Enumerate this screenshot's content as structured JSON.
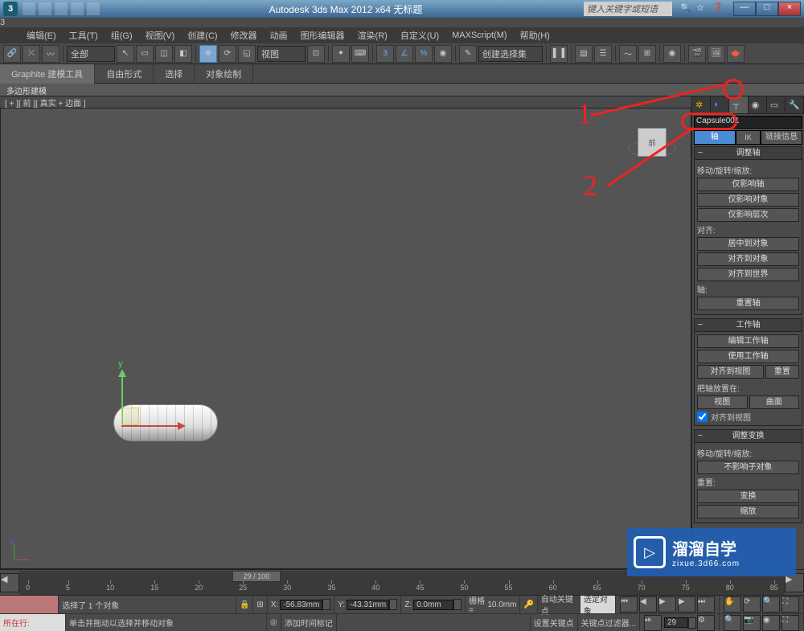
{
  "title": "Autodesk 3ds Max 2012 x64   无标题",
  "searchbox_placeholder": "键入关键字或短语",
  "win": {
    "min": "—",
    "max": "□",
    "close": "×"
  },
  "menus": [
    "编辑(E)",
    "工具(T)",
    "组(G)",
    "视图(V)",
    "创建(C)",
    "修改器",
    "动画",
    "图形编辑器",
    "渲染(R)",
    "自定义(U)",
    "MAXScript(M)",
    "帮助(H)"
  ],
  "toolbar": {
    "layer_dd": "全部",
    "selset_dd": "创建选择集",
    "view_dd": "视图"
  },
  "ribbon": {
    "t1": "Graphite 建模工具",
    "t2": "自由形式",
    "t3": "选择",
    "t4": "对象绘制",
    "sub": "多边形建模"
  },
  "viewport_label": "[ + ][ 前 ][ 真实 + 边面 ]",
  "viewcube": "前",
  "gizmo": {
    "y": "y"
  },
  "cmd": {
    "obj_name": "Capsule001",
    "subtabs": {
      "pivot": "轴",
      "ik": "IK",
      "link": "链接信息"
    },
    "r1": {
      "header": "调整轴",
      "label1": "移动/旋转/缩放:",
      "b1": "仅影响轴",
      "b2": "仅影响对象",
      "b3": "仅影响层次",
      "label2": "对齐:",
      "b4": "居中到对象",
      "b5": "对齐到对象",
      "b6": "对齐到世界",
      "label3": "轴:",
      "b7": "重置轴"
    },
    "r2": {
      "header": "工作轴",
      "b1": "编辑工作轴",
      "b2": "使用工作轴",
      "b3": "对齐到视图",
      "b4": "重置",
      "label1": "把轴放置在:",
      "b5": "视图",
      "b6": "曲面",
      "chk": "对齐到视图"
    },
    "r3": {
      "header": "调整变换",
      "label1": "移动/旋转/缩放:",
      "b1": "不影响子对象",
      "label2": "重置:",
      "b2": "变换",
      "b3": "缩放"
    }
  },
  "timeline": {
    "pos": "29 / 100",
    "t0": "0",
    "t5": "5",
    "t10": "10",
    "t15": "15",
    "t20": "20",
    "t25": "25",
    "t30": "30",
    "t35": "35",
    "t40": "40",
    "t45": "45",
    "t50": "50",
    "t55": "55",
    "t60": "60",
    "t65": "65",
    "t70": "70",
    "t75": "75",
    "t80": "80",
    "t85": "85"
  },
  "status": {
    "sel": "选择了 1 个对象",
    "hint": "单击并拖动以选择并移动对象",
    "x_lbl": "X:",
    "x": "-56.83mm",
    "y_lbl": "Y:",
    "y": "-43.31mm",
    "z_lbl": "Z:",
    "z": "0.0mm",
    "grid_lbl": "栅格 =",
    "grid": "10.0mm",
    "autokey": "自动关键点",
    "selset": "选定对象",
    "setkey": "设置关键点",
    "keyfilter": "关键点过滤器...",
    "frame": "29",
    "addtag": "添加时间标记",
    "layer_lbl": "所在行:"
  },
  "anno": {
    "n1": "1",
    "n2": "2"
  },
  "watermark": {
    "big": "溜溜自学",
    "small": "zixue.3d66.com"
  }
}
